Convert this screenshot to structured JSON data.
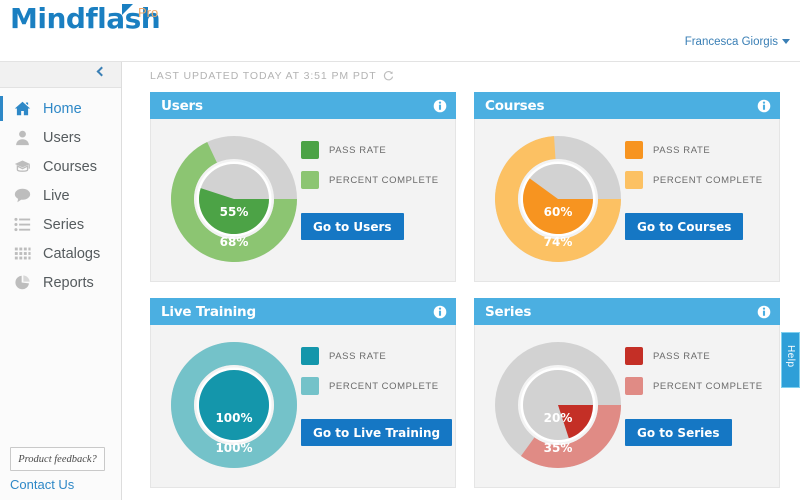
{
  "header": {
    "logo_text": "Mindflash",
    "logo_badge": "Pro",
    "user_name": "Francesca Giorgis"
  },
  "sidebar": {
    "collapse_icon": "chevron-left-icon",
    "items": [
      {
        "label": "Home",
        "icon": "home-icon",
        "active": true
      },
      {
        "label": "Users",
        "icon": "user-icon",
        "active": false
      },
      {
        "label": "Courses",
        "icon": "graduation-cap-icon",
        "active": false
      },
      {
        "label": "Live",
        "icon": "chat-bubble-icon",
        "active": false
      },
      {
        "label": "Series",
        "icon": "list-icon",
        "active": false
      },
      {
        "label": "Catalogs",
        "icon": "grid-icon",
        "active": false
      },
      {
        "label": "Reports",
        "icon": "pie-chart-icon",
        "active": false
      }
    ],
    "feedback_label": "Product feedback?",
    "contact_label": "Contact Us"
  },
  "main": {
    "last_updated": "LAST UPDATED TODAY AT 3:51 PM PDT",
    "refresh_icon": "refresh-icon"
  },
  "help_tab": {
    "label": "Help"
  },
  "colors": {
    "card_header_blue": "#4bafe1",
    "button_blue": "#1577c4",
    "link_blue": "#2e88c7",
    "track_gray": "#d2d2d2",
    "logo_blue": "#1a7fc1",
    "logo_orange": "#f0a868"
  },
  "legend_labels": {
    "pass_rate": "PASS RATE",
    "percent_complete": "PERCENT COMPLETE"
  },
  "cards": [
    {
      "title": "Users",
      "button_label": "Go to Users",
      "pass_rate": 55,
      "percent_complete": 68,
      "pass_rate_text": "55%",
      "percent_complete_text": "68%",
      "color_dark": "#4ca346",
      "color_light": "#8cc572"
    },
    {
      "title": "Courses",
      "button_label": "Go to Courses",
      "pass_rate": 60,
      "percent_complete": 74,
      "pass_rate_text": "60%",
      "percent_complete_text": "74%",
      "color_dark": "#f79420",
      "color_light": "#fcc163"
    },
    {
      "title": "Live Training",
      "button_label": "Go to Live Training",
      "pass_rate": 100,
      "percent_complete": 100,
      "pass_rate_text": "100%",
      "percent_complete_text": "100%",
      "color_dark": "#1496ab",
      "color_light": "#74c2c9"
    },
    {
      "title": "Series",
      "button_label": "Go to Series",
      "pass_rate": 20,
      "percent_complete": 35,
      "pass_rate_text": "20%",
      "percent_complete_text": "35%",
      "color_dark": "#c42f26",
      "color_light": "#e08b85"
    }
  ],
  "chart_data": [
    {
      "type": "pie",
      "title": "Users",
      "labels": [
        "PASS RATE",
        "PERCENT COMPLETE"
      ],
      "series": [
        {
          "name": "PASS RATE",
          "value": 55,
          "ring": "inner",
          "color": "#4ca346"
        },
        {
          "name": "PERCENT COMPLETE",
          "value": 68,
          "ring": "outer",
          "color": "#8cc572"
        }
      ],
      "remainder_color": "#d2d2d2",
      "units": "percent",
      "legend_position": "right"
    },
    {
      "type": "pie",
      "title": "Courses",
      "labels": [
        "PASS RATE",
        "PERCENT COMPLETE"
      ],
      "series": [
        {
          "name": "PASS RATE",
          "value": 60,
          "ring": "inner",
          "color": "#f79420"
        },
        {
          "name": "PERCENT COMPLETE",
          "value": 74,
          "ring": "outer",
          "color": "#fcc163"
        }
      ],
      "remainder_color": "#d2d2d2",
      "units": "percent",
      "legend_position": "right"
    },
    {
      "type": "pie",
      "title": "Live Training",
      "labels": [
        "PASS RATE",
        "PERCENT COMPLETE"
      ],
      "series": [
        {
          "name": "PASS RATE",
          "value": 100,
          "ring": "inner",
          "color": "#1496ab"
        },
        {
          "name": "PERCENT COMPLETE",
          "value": 100,
          "ring": "outer",
          "color": "#74c2c9"
        }
      ],
      "remainder_color": "#d2d2d2",
      "units": "percent",
      "legend_position": "right"
    },
    {
      "type": "pie",
      "title": "Series",
      "labels": [
        "PASS RATE",
        "PERCENT COMPLETE"
      ],
      "series": [
        {
          "name": "PASS RATE",
          "value": 20,
          "ring": "inner",
          "color": "#c42f26"
        },
        {
          "name": "PERCENT COMPLETE",
          "value": 35,
          "ring": "outer",
          "color": "#e08b85"
        }
      ],
      "remainder_color": "#d2d2d2",
      "units": "percent",
      "legend_position": "right"
    }
  ]
}
